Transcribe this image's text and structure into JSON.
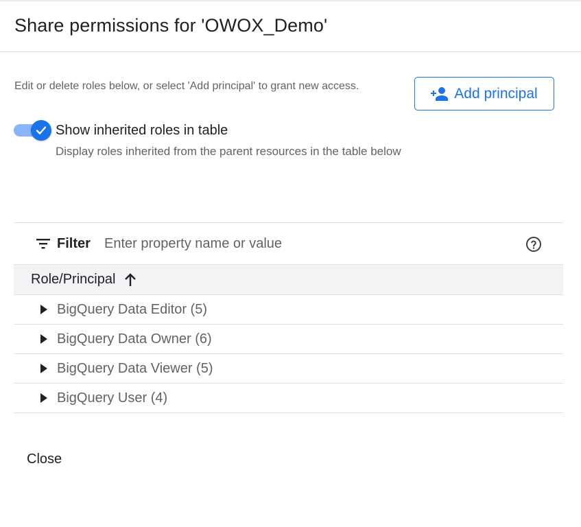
{
  "dialog": {
    "title": "Share permissions for 'OWOX_Demo'",
    "description": "Edit or delete roles below, or select 'Add principal' to grant new access.",
    "add_principal_label": "Add principal",
    "accent_color": "#1a73e8"
  },
  "inherited_toggle": {
    "checked": true,
    "label": "Show inherited roles in table",
    "sublabel": "Display roles inherited from the parent resources in the table below"
  },
  "filter": {
    "label": "Filter",
    "placeholder": "Enter property name or value"
  },
  "table": {
    "column_header": "Role/Principal",
    "sort": "ascending",
    "rows": [
      {
        "label": "BigQuery Data Editor (5)",
        "expanded": false
      },
      {
        "label": "BigQuery Data Owner (6)",
        "expanded": false
      },
      {
        "label": "BigQuery Data Viewer (5)",
        "expanded": false
      },
      {
        "label": "BigQuery User (4)",
        "expanded": false
      }
    ]
  },
  "footer": {
    "close_label": "Close"
  },
  "icons": {
    "add_principal": "person-add-icon",
    "toggle_thumb": "check-icon",
    "filter": "filter-list-icon",
    "help": "help-circle-icon",
    "sort": "arrow-up-icon",
    "row_expand": "caret-right-icon"
  }
}
